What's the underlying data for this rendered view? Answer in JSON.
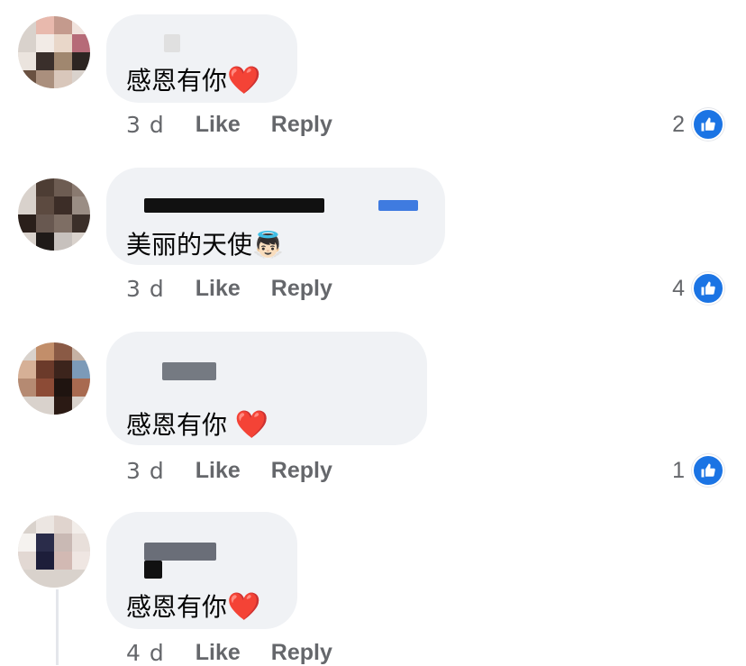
{
  "comments": [
    {
      "text": "感恩有你",
      "emoji": "❤️",
      "time": "3 d",
      "like": "Like",
      "reply": "Reply",
      "reactions": "2"
    },
    {
      "text": "美丽的天使",
      "emoji": "👼🏻",
      "time": "3 d",
      "like": "Like",
      "reply": "Reply",
      "reactions": "4"
    },
    {
      "text": "感恩有你",
      "emoji": "❤️",
      "time": "3 d",
      "like": "Like",
      "reply": "Reply",
      "reactions": "1"
    },
    {
      "text": "感恩有你",
      "emoji": "❤️",
      "time": "4 d",
      "like": "Like",
      "reply": "Reply",
      "reactions": ""
    }
  ],
  "colors": {
    "accent": "#1b74e4",
    "bubble": "#f0f2f5",
    "meta": "#65676b",
    "heart": "#e0252b"
  }
}
